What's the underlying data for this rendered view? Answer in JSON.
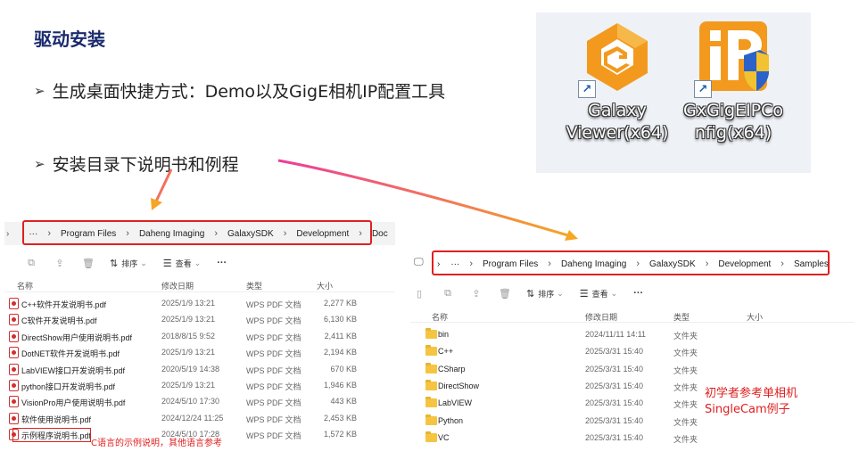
{
  "slide": {
    "title": "驱动安装",
    "bullets": [
      "生成桌面快捷方式：Demo以及GigE相机IP配置工具",
      "安装目录下说明书和例程"
    ],
    "bullet_mark": "➢"
  },
  "desktop": {
    "icons": [
      {
        "label_line1": "Galaxy",
        "label_line2": "Viewer(x64)",
        "icon": "galaxy-viewer-icon",
        "color": "#f39a1e"
      },
      {
        "label_line1": "GxGigEIPCo",
        "label_line2": "nfig(x64)",
        "icon": "gige-ip-config-icon",
        "color": "#f39a1e"
      }
    ]
  },
  "left_explorer": {
    "path": [
      "Program Files",
      "Daheng Imaging",
      "GalaxySDK",
      "Development",
      "Doc"
    ],
    "toolbar": {
      "sort": "排序",
      "view": "查看",
      "more": "···"
    },
    "headers": {
      "name": "名称",
      "date": "修改日期",
      "type": "类型",
      "size": "大小"
    },
    "files": [
      {
        "name": "C++软件开发说明书.pdf",
        "date": "2025/1/9 13:21",
        "type": "WPS PDF 文档",
        "size": "2,277 KB"
      },
      {
        "name": "C软件开发说明书.pdf",
        "date": "2025/1/9 13:21",
        "type": "WPS PDF 文档",
        "size": "6,130 KB"
      },
      {
        "name": "DirectShow用户使用说明书.pdf",
        "date": "2018/8/15 9:52",
        "type": "WPS PDF 文档",
        "size": "2,411 KB"
      },
      {
        "name": "DotNET软件开发说明书.pdf",
        "date": "2025/1/9 13:21",
        "type": "WPS PDF 文档",
        "size": "2,194 KB"
      },
      {
        "name": "LabVIEW接口开发说明书.pdf",
        "date": "2020/5/19 14:38",
        "type": "WPS PDF 文档",
        "size": "670 KB"
      },
      {
        "name": "python接口开发说明书.pdf",
        "date": "2025/1/9 13:21",
        "type": "WPS PDF 文档",
        "size": "1,946 KB"
      },
      {
        "name": "VisionPro用户使用说明书.pdf",
        "date": "2024/5/10 17:30",
        "type": "WPS PDF 文档",
        "size": "443 KB"
      },
      {
        "name": "软件使用说明书.pdf",
        "date": "2024/12/24 11:25",
        "type": "WPS PDF 文档",
        "size": "2,453 KB"
      },
      {
        "name": "示例程序说明书.pdf",
        "date": "2024/5/10 17:28",
        "type": "WPS PDF 文档",
        "size": "1,572 KB"
      }
    ],
    "note": "C语言的示例说明，其他语言参考"
  },
  "right_explorer": {
    "path": [
      "Program Files",
      "Daheng Imaging",
      "GalaxySDK",
      "Development",
      "Samples"
    ],
    "toolbar": {
      "sort": "排序",
      "view": "查看",
      "more": "···"
    },
    "headers": {
      "name": "名称",
      "date": "修改日期",
      "type": "类型",
      "size": "大小"
    },
    "folders": [
      {
        "name": "bin",
        "date": "2024/11/11 14:11",
        "type": "文件夹"
      },
      {
        "name": "C++",
        "date": "2025/3/31 15:40",
        "type": "文件夹"
      },
      {
        "name": "CSharp",
        "date": "2025/3/31 15:40",
        "type": "文件夹"
      },
      {
        "name": "DirectShow",
        "date": "2025/3/31 15:40",
        "type": "文件夹"
      },
      {
        "name": "LabVIEW",
        "date": "2025/3/31 15:40",
        "type": "文件夹"
      },
      {
        "name": "Python",
        "date": "2025/3/31 15:40",
        "type": "文件夹"
      },
      {
        "name": "VC",
        "date": "2025/3/31 15:40",
        "type": "文件夹"
      }
    ],
    "note_line1": "初学者参考单相机",
    "note_line2": "SingleCam例子"
  },
  "colors": {
    "accent_red": "#e02020",
    "title_navy": "#1a2a6c",
    "arrow_start": "#ee3b9b",
    "arrow_end": "#f5a623"
  }
}
